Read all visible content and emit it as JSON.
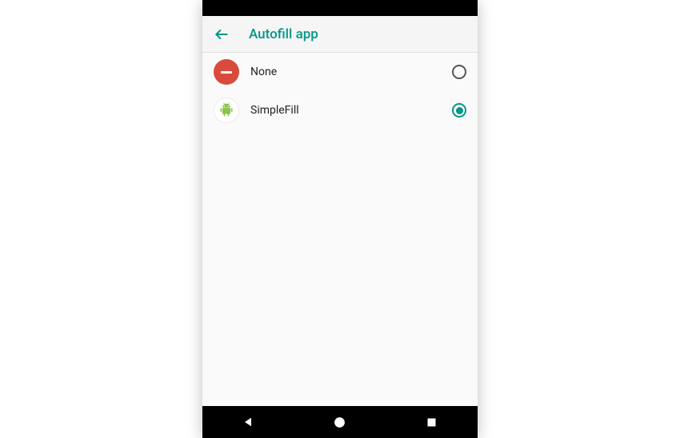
{
  "header": {
    "title": "Autofill app"
  },
  "options": [
    {
      "label": "None",
      "icon": "none-icon",
      "selected": false
    },
    {
      "label": "SimpleFill",
      "icon": "android-icon",
      "selected": true
    }
  ],
  "colors": {
    "accent": "#009688",
    "none_icon": "#d94b3c",
    "android_green": "#8bc34a"
  }
}
